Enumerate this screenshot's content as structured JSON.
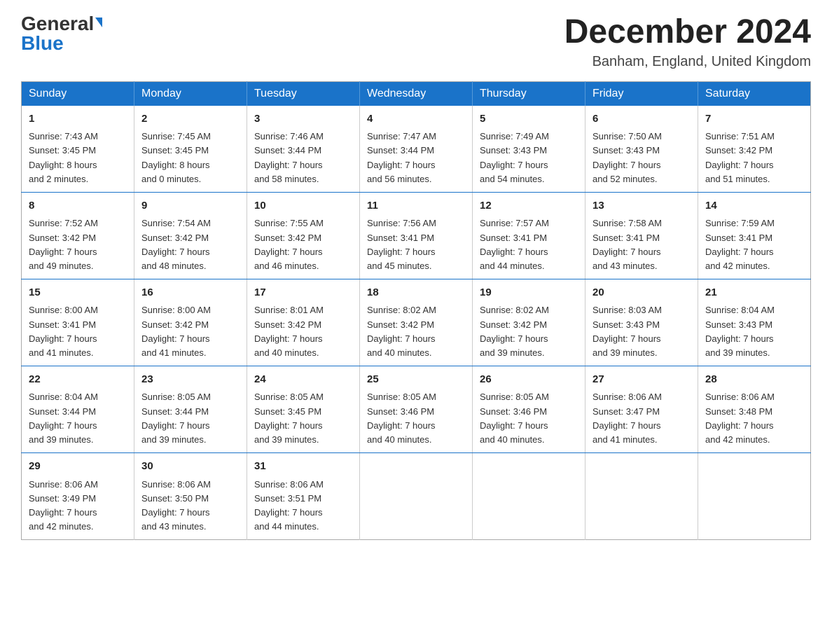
{
  "logo": {
    "general": "General",
    "blue": "Blue"
  },
  "title": {
    "month": "December 2024",
    "location": "Banham, England, United Kingdom"
  },
  "weekdays": [
    "Sunday",
    "Monday",
    "Tuesday",
    "Wednesday",
    "Thursday",
    "Friday",
    "Saturday"
  ],
  "weeks": [
    [
      {
        "day": "1",
        "sunrise": "7:43 AM",
        "sunset": "3:45 PM",
        "daylight": "8 hours and 2 minutes."
      },
      {
        "day": "2",
        "sunrise": "7:45 AM",
        "sunset": "3:45 PM",
        "daylight": "8 hours and 0 minutes."
      },
      {
        "day": "3",
        "sunrise": "7:46 AM",
        "sunset": "3:44 PM",
        "daylight": "7 hours and 58 minutes."
      },
      {
        "day": "4",
        "sunrise": "7:47 AM",
        "sunset": "3:44 PM",
        "daylight": "7 hours and 56 minutes."
      },
      {
        "day": "5",
        "sunrise": "7:49 AM",
        "sunset": "3:43 PM",
        "daylight": "7 hours and 54 minutes."
      },
      {
        "day": "6",
        "sunrise": "7:50 AM",
        "sunset": "3:43 PM",
        "daylight": "7 hours and 52 minutes."
      },
      {
        "day": "7",
        "sunrise": "7:51 AM",
        "sunset": "3:42 PM",
        "daylight": "7 hours and 51 minutes."
      }
    ],
    [
      {
        "day": "8",
        "sunrise": "7:52 AM",
        "sunset": "3:42 PM",
        "daylight": "7 hours and 49 minutes."
      },
      {
        "day": "9",
        "sunrise": "7:54 AM",
        "sunset": "3:42 PM",
        "daylight": "7 hours and 48 minutes."
      },
      {
        "day": "10",
        "sunrise": "7:55 AM",
        "sunset": "3:42 PM",
        "daylight": "7 hours and 46 minutes."
      },
      {
        "day": "11",
        "sunrise": "7:56 AM",
        "sunset": "3:41 PM",
        "daylight": "7 hours and 45 minutes."
      },
      {
        "day": "12",
        "sunrise": "7:57 AM",
        "sunset": "3:41 PM",
        "daylight": "7 hours and 44 minutes."
      },
      {
        "day": "13",
        "sunrise": "7:58 AM",
        "sunset": "3:41 PM",
        "daylight": "7 hours and 43 minutes."
      },
      {
        "day": "14",
        "sunrise": "7:59 AM",
        "sunset": "3:41 PM",
        "daylight": "7 hours and 42 minutes."
      }
    ],
    [
      {
        "day": "15",
        "sunrise": "8:00 AM",
        "sunset": "3:41 PM",
        "daylight": "7 hours and 41 minutes."
      },
      {
        "day": "16",
        "sunrise": "8:00 AM",
        "sunset": "3:42 PM",
        "daylight": "7 hours and 41 minutes."
      },
      {
        "day": "17",
        "sunrise": "8:01 AM",
        "sunset": "3:42 PM",
        "daylight": "7 hours and 40 minutes."
      },
      {
        "day": "18",
        "sunrise": "8:02 AM",
        "sunset": "3:42 PM",
        "daylight": "7 hours and 40 minutes."
      },
      {
        "day": "19",
        "sunrise": "8:02 AM",
        "sunset": "3:42 PM",
        "daylight": "7 hours and 39 minutes."
      },
      {
        "day": "20",
        "sunrise": "8:03 AM",
        "sunset": "3:43 PM",
        "daylight": "7 hours and 39 minutes."
      },
      {
        "day": "21",
        "sunrise": "8:04 AM",
        "sunset": "3:43 PM",
        "daylight": "7 hours and 39 minutes."
      }
    ],
    [
      {
        "day": "22",
        "sunrise": "8:04 AM",
        "sunset": "3:44 PM",
        "daylight": "7 hours and 39 minutes."
      },
      {
        "day": "23",
        "sunrise": "8:05 AM",
        "sunset": "3:44 PM",
        "daylight": "7 hours and 39 minutes."
      },
      {
        "day": "24",
        "sunrise": "8:05 AM",
        "sunset": "3:45 PM",
        "daylight": "7 hours and 39 minutes."
      },
      {
        "day": "25",
        "sunrise": "8:05 AM",
        "sunset": "3:46 PM",
        "daylight": "7 hours and 40 minutes."
      },
      {
        "day": "26",
        "sunrise": "8:05 AM",
        "sunset": "3:46 PM",
        "daylight": "7 hours and 40 minutes."
      },
      {
        "day": "27",
        "sunrise": "8:06 AM",
        "sunset": "3:47 PM",
        "daylight": "7 hours and 41 minutes."
      },
      {
        "day": "28",
        "sunrise": "8:06 AM",
        "sunset": "3:48 PM",
        "daylight": "7 hours and 42 minutes."
      }
    ],
    [
      {
        "day": "29",
        "sunrise": "8:06 AM",
        "sunset": "3:49 PM",
        "daylight": "7 hours and 42 minutes."
      },
      {
        "day": "30",
        "sunrise": "8:06 AM",
        "sunset": "3:50 PM",
        "daylight": "7 hours and 43 minutes."
      },
      {
        "day": "31",
        "sunrise": "8:06 AM",
        "sunset": "3:51 PM",
        "daylight": "7 hours and 44 minutes."
      },
      null,
      null,
      null,
      null
    ]
  ],
  "labels": {
    "sunrise": "Sunrise:",
    "sunset": "Sunset:",
    "daylight": "Daylight:"
  }
}
